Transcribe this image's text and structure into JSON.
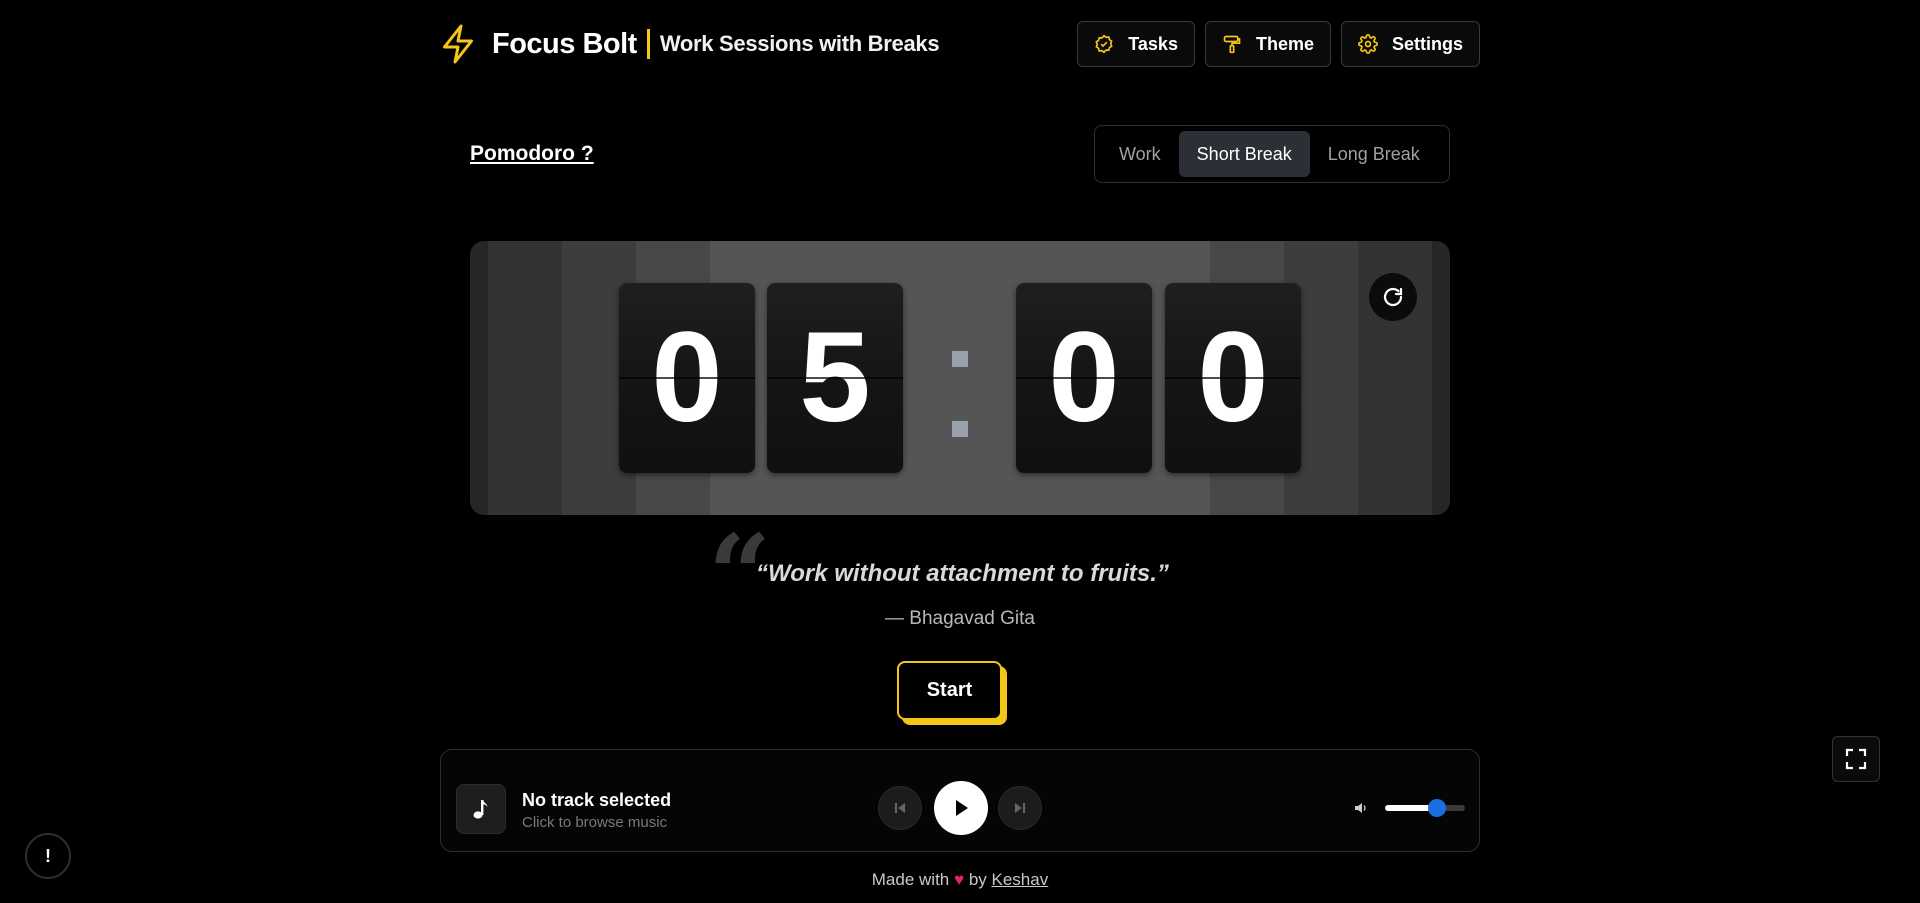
{
  "header": {
    "brand_name": "Focus Bolt",
    "brand_subtitle": "Work Sessions with Breaks",
    "accent_color": "#f5c518",
    "nav": [
      {
        "label": "Tasks",
        "icon": "check-circle-icon"
      },
      {
        "label": "Theme",
        "icon": "paint-roller-icon"
      },
      {
        "label": "Settings",
        "icon": "gear-icon"
      }
    ]
  },
  "pomodoro_link": "Pomodoro ?",
  "modes": {
    "tabs": [
      "Work",
      "Short Break",
      "Long Break"
    ],
    "active": "Short Break"
  },
  "timer": {
    "digits": [
      "0",
      "5",
      "0",
      "0"
    ],
    "reset_icon": "refresh-icon"
  },
  "quote": {
    "text": "“Work without attachment to fruits.”",
    "author": "— Bhagavad Gita"
  },
  "start_label": "Start",
  "player": {
    "title": "No track selected",
    "subtitle": "Click to browse music",
    "volume_fraction": 0.65,
    "volume_thumb_color": "#1a6fe0"
  },
  "footer": {
    "prefix": "Made with",
    "heart": "♥",
    "by": "by",
    "author": "Keshav"
  },
  "info_label": "!"
}
